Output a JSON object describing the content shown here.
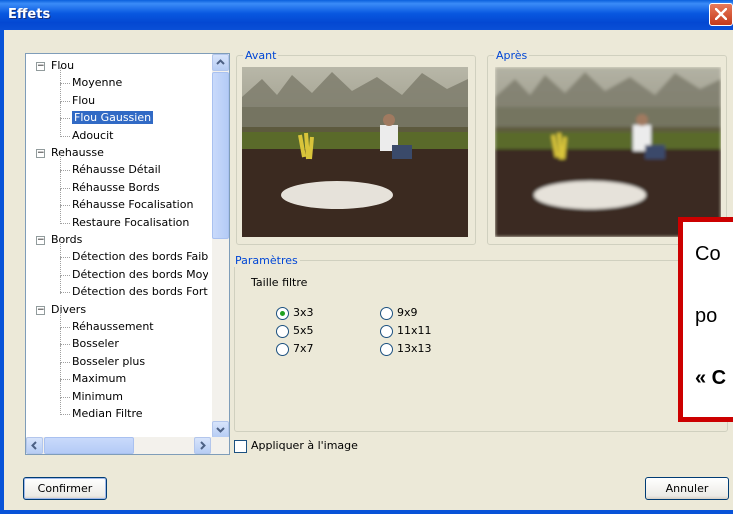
{
  "window": {
    "title": "Effets"
  },
  "tree": {
    "nodes": [
      {
        "label": "Flou",
        "level": 0,
        "expander": "−"
      },
      {
        "label": "Moyenne",
        "level": 1
      },
      {
        "label": "Flou",
        "level": 1
      },
      {
        "label": "Flou Gaussien",
        "level": 1,
        "selected": true
      },
      {
        "label": "Adoucit",
        "level": 1
      },
      {
        "label": "Rehausse",
        "level": 0,
        "expander": "−"
      },
      {
        "label": "Réhausse Détail",
        "level": 1
      },
      {
        "label": "Réhausse Bords",
        "level": 1
      },
      {
        "label": "Réhausse Focalisation",
        "level": 1
      },
      {
        "label": "Restaure Focalisation",
        "level": 1
      },
      {
        "label": "Bords",
        "level": 0,
        "expander": "−"
      },
      {
        "label": "Détection des bords Faible",
        "level": 1
      },
      {
        "label": "Détection des bords Moyen",
        "level": 1
      },
      {
        "label": "Détection des bords Fort",
        "level": 1
      },
      {
        "label": "Divers",
        "level": 0,
        "expander": "−"
      },
      {
        "label": "Réhaussement",
        "level": 1
      },
      {
        "label": "Bosseler",
        "level": 1
      },
      {
        "label": "Bosseler plus",
        "level": 1
      },
      {
        "label": "Maximum",
        "level": 1
      },
      {
        "label": "Minimum",
        "level": 1
      },
      {
        "label": "Median Filtre",
        "level": 1
      }
    ]
  },
  "preview": {
    "before_label": "Avant",
    "after_label": "Après"
  },
  "params": {
    "legend": "Paramètres",
    "size_label": "Taille filtre",
    "options": [
      "3x3",
      "5x5",
      "7x7",
      "9x9",
      "11x11",
      "13x13"
    ],
    "selected": "3x3"
  },
  "apply_checkbox": {
    "label": "Appliquer à l'image",
    "checked": false
  },
  "buttons": {
    "confirm": "Confirmer",
    "cancel": "Annuler"
  },
  "callout": {
    "lines": [
      "Co",
      "po",
      "« C"
    ]
  },
  "colors": {
    "accent": "#0046d5",
    "titlebar": "#0a5fdc",
    "callout_border": "#cc0000",
    "selection": "#316ac5"
  }
}
